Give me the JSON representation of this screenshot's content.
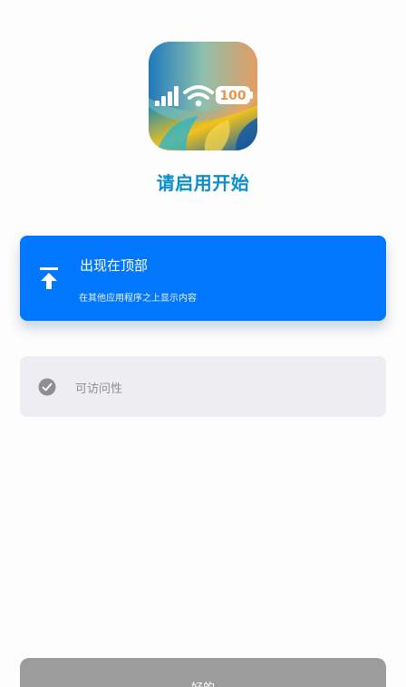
{
  "app_icon": {
    "icon": "signal-wifi-battery-wallpaper-icon",
    "battery_text": "100"
  },
  "title": "请启用开始",
  "options": {
    "top": {
      "icon": "pin-to-top-icon",
      "label": "出现在顶部",
      "description": "在其他应用程序之上显示内容",
      "color": "#0077fc",
      "selected": true
    },
    "accessibility": {
      "icon": "check-circle-icon",
      "label": "可访问性",
      "color": "#eeeef2",
      "selected": false
    }
  },
  "ok_button": {
    "label": "好的",
    "color": "#9c9c9c"
  },
  "accent_color": "#0b8fc9"
}
